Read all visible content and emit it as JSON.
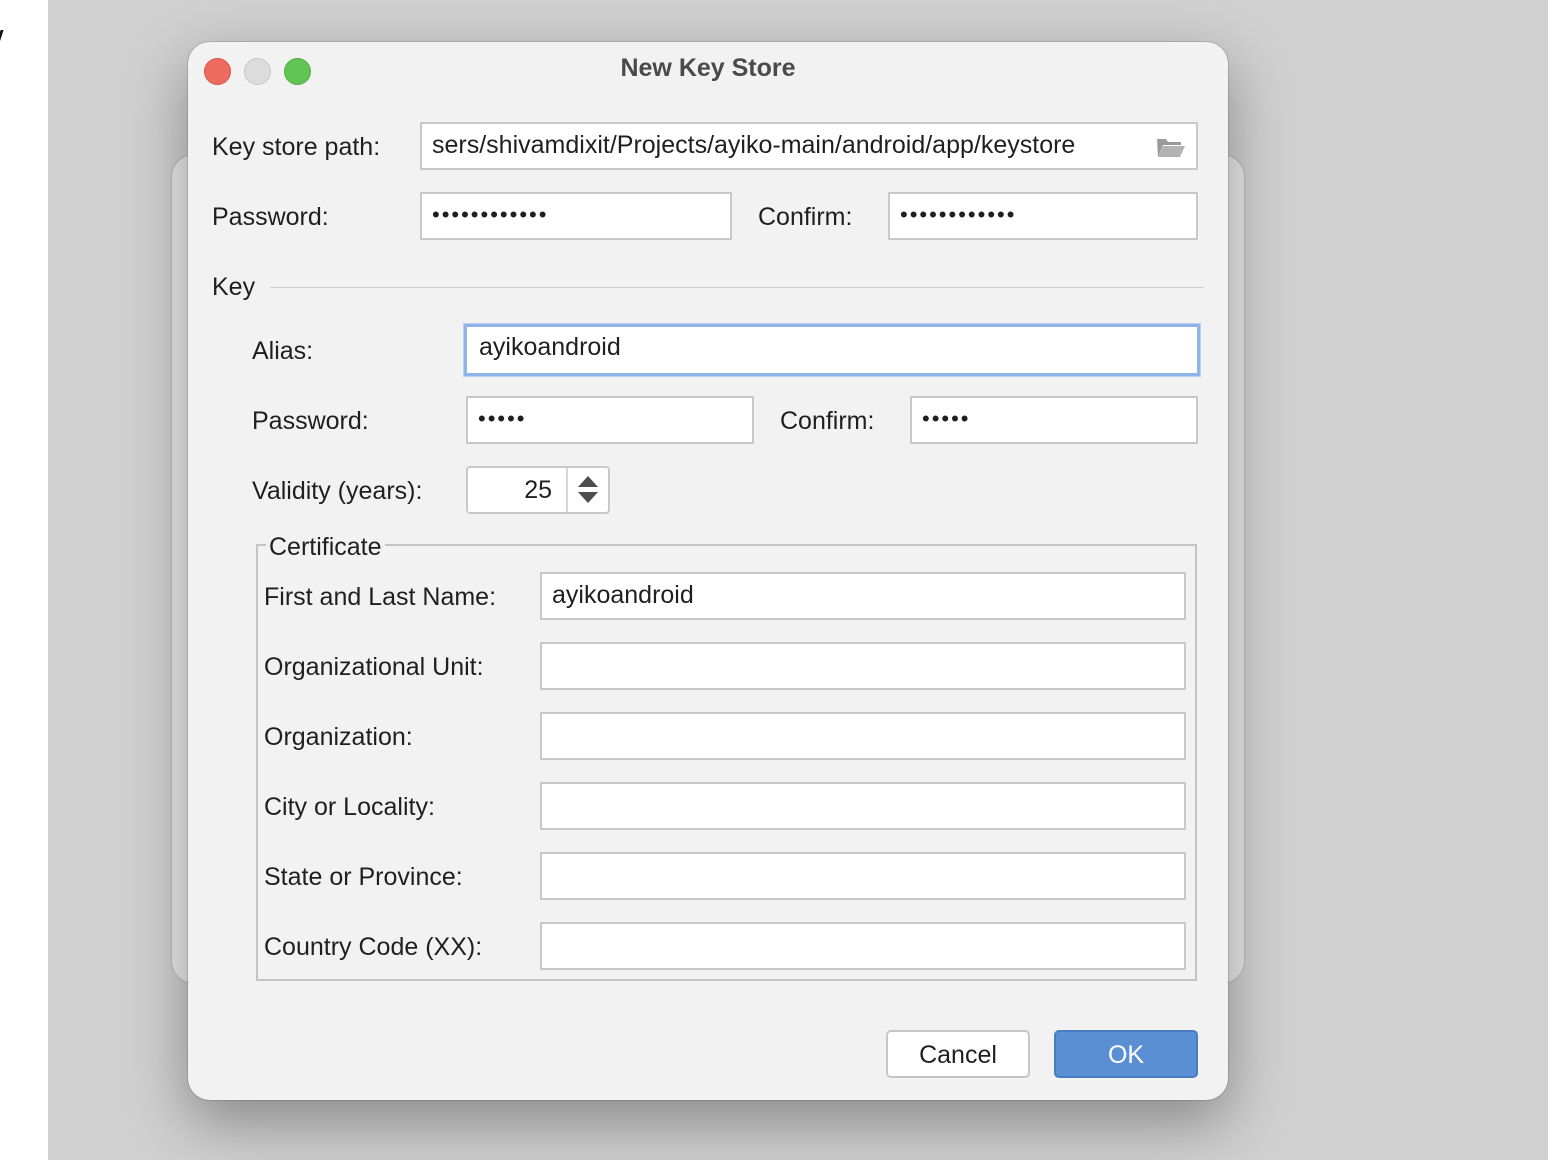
{
  "dialog": {
    "title": "New Key Store"
  },
  "keystore": {
    "path_label": "Key store path:",
    "path_value": "sers/shivamdixit/Projects/ayiko-main/android/app/keystore",
    "password_label": "Password:",
    "password_value": "••••••••••••",
    "confirm_label": "Confirm:",
    "confirm_value": "••••••••••••"
  },
  "key": {
    "section_label": "Key",
    "alias_label": "Alias:",
    "alias_value": "ayikoandroid",
    "password_label": "Password:",
    "password_value": "•••••",
    "confirm_label": "Confirm:",
    "confirm_value": "•••••",
    "validity_label": "Validity (years):",
    "validity_value": "25"
  },
  "certificate": {
    "section_label": "Certificate",
    "fields": [
      {
        "label": "First and Last Name:",
        "value": "ayikoandroid"
      },
      {
        "label": "Organizational Unit:",
        "value": ""
      },
      {
        "label": "Organization:",
        "value": ""
      },
      {
        "label": "City or Locality:",
        "value": ""
      },
      {
        "label": "State or Province:",
        "value": ""
      },
      {
        "label": "Country Code (XX):",
        "value": ""
      }
    ]
  },
  "buttons": {
    "cancel": "Cancel",
    "ok": "OK"
  },
  "icons": {
    "path_browse": "folder-open-icon",
    "spinner_up": "arrow-up-icon",
    "spinner_down": "arrow-down-icon"
  },
  "colors": {
    "ok_button": "#5b8fd3",
    "close": "#ed6a5e",
    "maximize": "#61c554",
    "focus_ring": "#8fb4e8"
  }
}
